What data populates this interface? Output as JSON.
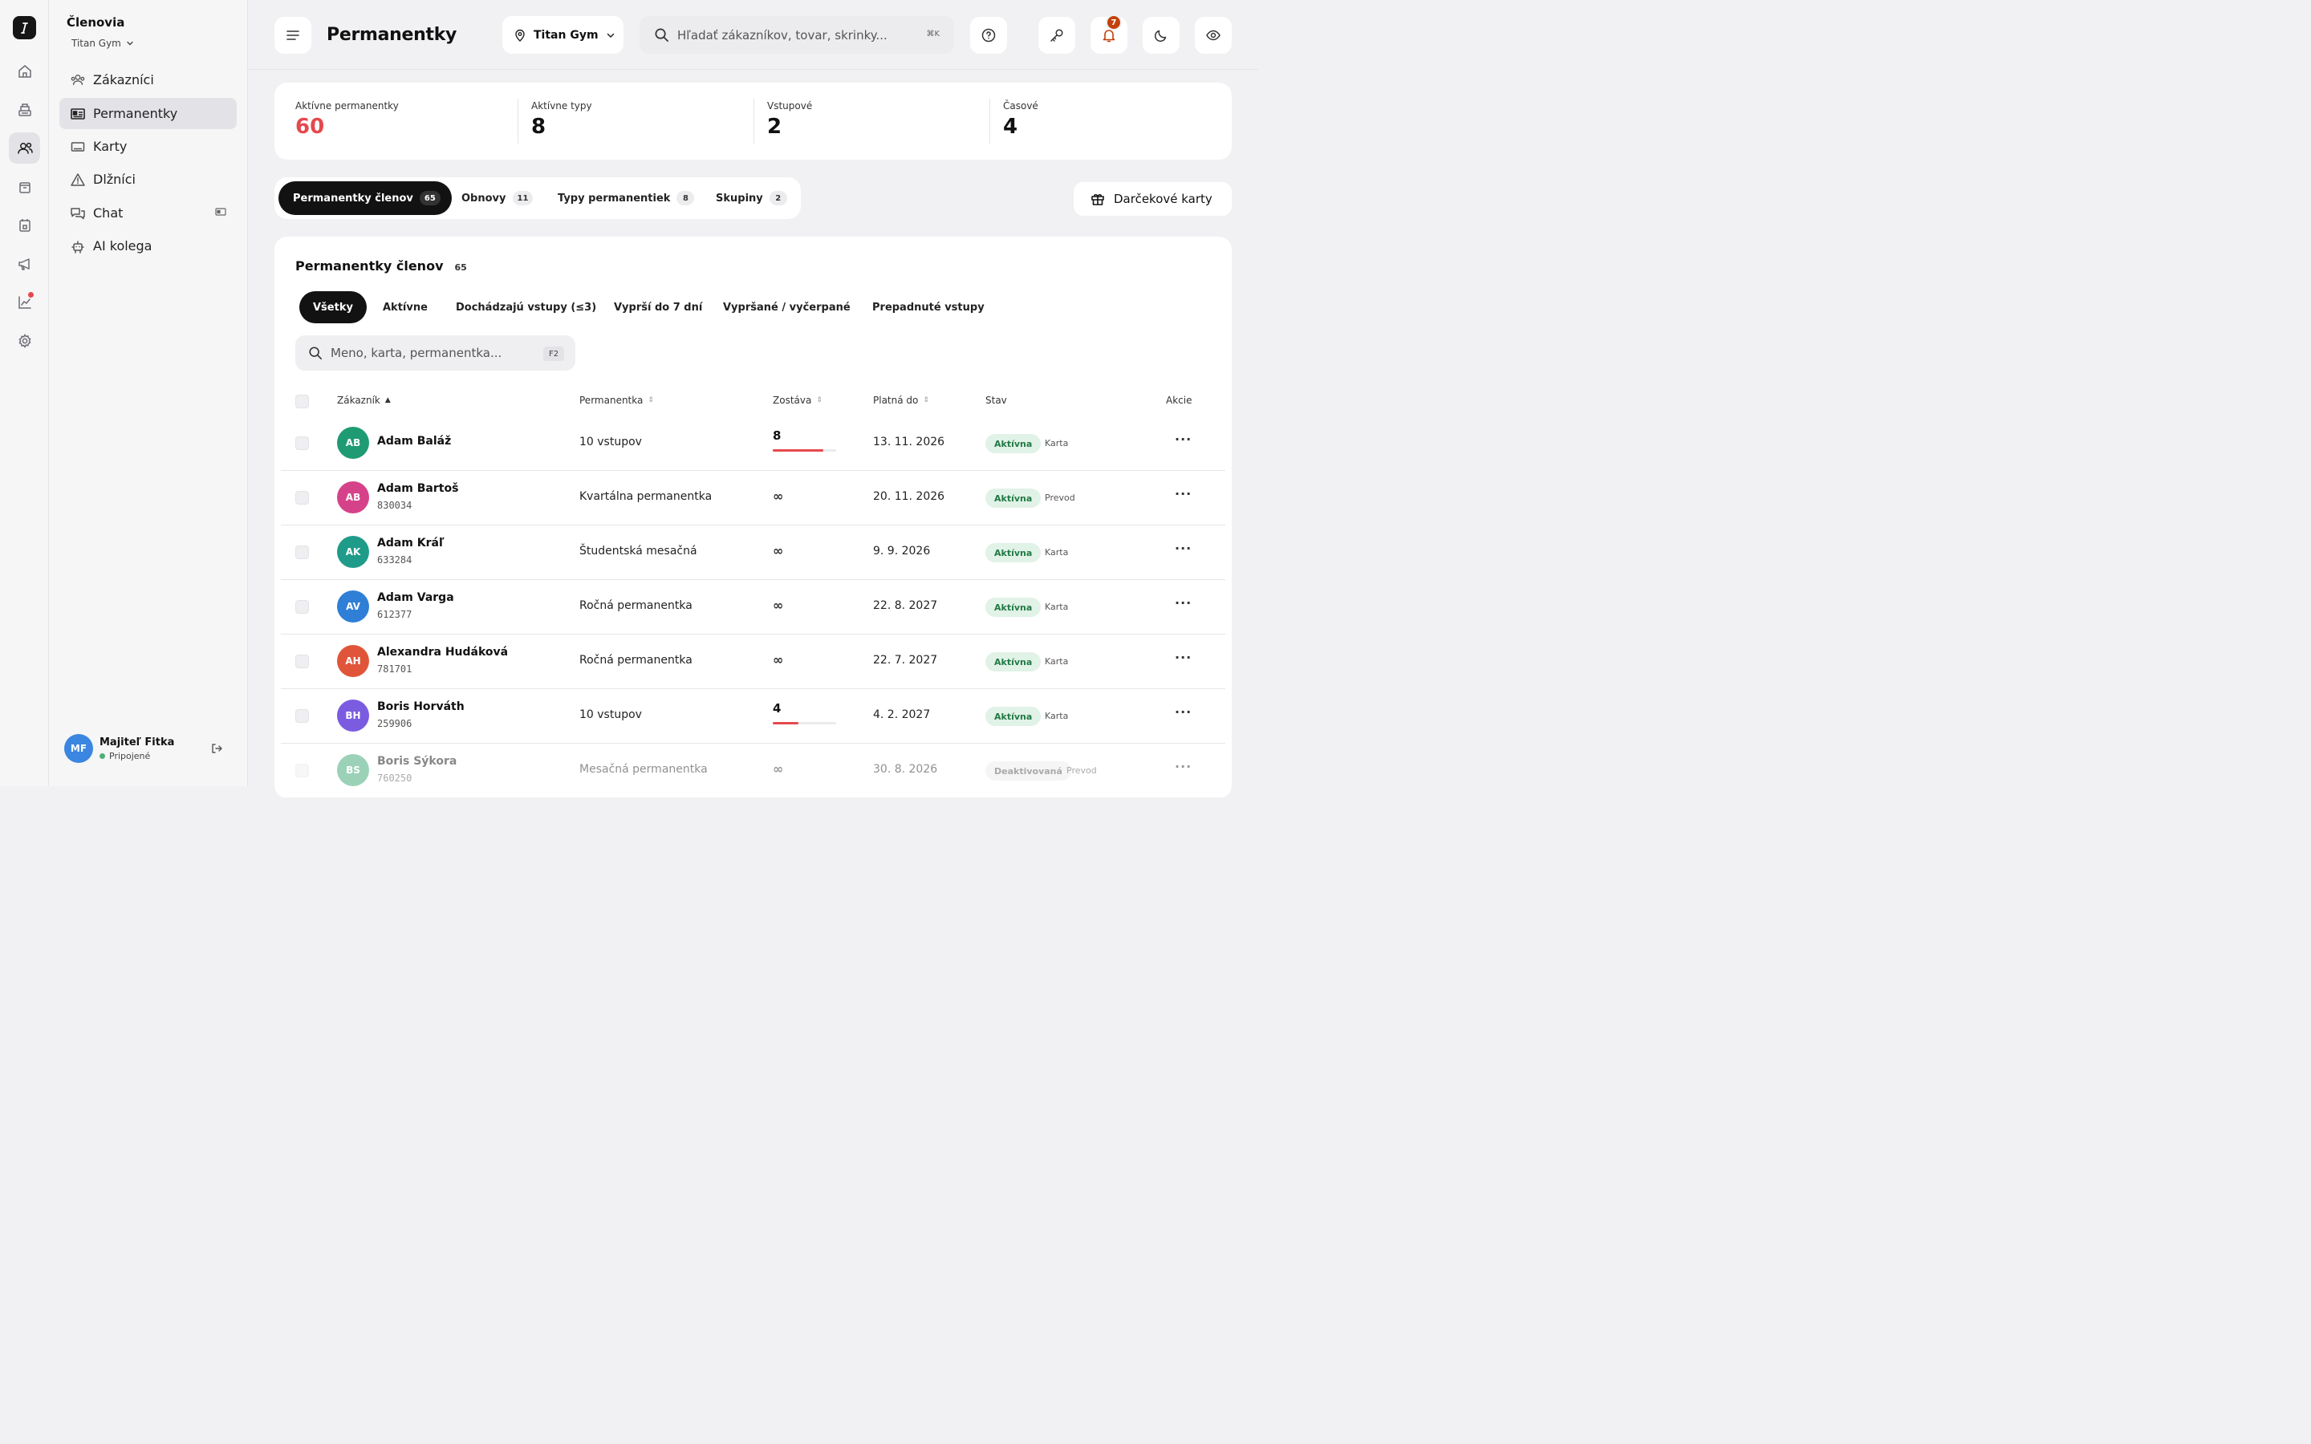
{
  "rail": {
    "items": [
      {
        "icon": "home-icon"
      },
      {
        "icon": "register-icon"
      },
      {
        "icon": "members-icon",
        "active": true
      },
      {
        "icon": "box-icon"
      },
      {
        "icon": "calendar-icon"
      },
      {
        "icon": "megaphone-icon"
      },
      {
        "icon": "analytics-icon",
        "dot": true
      },
      {
        "icon": "settings-icon"
      }
    ]
  },
  "sidebar": {
    "title": "Členovia",
    "gym": "Titan Gym",
    "items": [
      {
        "label": "Zákazníci",
        "icon": "customers-icon"
      },
      {
        "label": "Permanentky",
        "icon": "pass-icon",
        "active": true
      },
      {
        "label": "Karty",
        "icon": "card-icon"
      },
      {
        "label": "Dlžníci",
        "icon": "warning-icon"
      },
      {
        "label": "Chat",
        "icon": "chat-icon"
      },
      {
        "label": "AI kolega",
        "icon": "robot-icon"
      }
    ],
    "user": {
      "initials": "MF",
      "name": "Majiteľ Fitka",
      "status": "Pripojené"
    }
  },
  "header": {
    "title": "Permanentky",
    "location": "Titan Gym",
    "search_placeholder": "Hľadať zákazníkov, tovar, skrinky...",
    "search_shortcut": "⌘K",
    "notifications": "7"
  },
  "stats": [
    {
      "label": "Aktívne permanentky",
      "value": "60",
      "color": "#e5484d"
    },
    {
      "label": "Aktívne typy",
      "value": "8",
      "color": "#111111"
    },
    {
      "label": "Vstupové",
      "value": "2",
      "color": "#111111"
    },
    {
      "label": "Časové",
      "value": "4",
      "color": "#111111"
    }
  ],
  "tabs": [
    {
      "label": "Permanentky členov",
      "count": "65",
      "active": true
    },
    {
      "label": "Obnovy",
      "count": "11"
    },
    {
      "label": "Typy permanentiek",
      "count": "8"
    },
    {
      "label": "Skupiny",
      "count": "2"
    }
  ],
  "gift_label": "Darčekové karty",
  "table": {
    "title": "Permanentky členov",
    "count": "65",
    "filters": [
      "Všetky",
      "Aktívne",
      "Dochádzajú vstupy (≤3)",
      "Vyprší do 7 dní",
      "Vypršané / vyčerpané",
      "Prepadnuté vstupy"
    ],
    "active_filter": 0,
    "search_placeholder": "Meno, karta, permanentka...",
    "search_shortcut": "F2",
    "columns": {
      "customer": "Zákazník",
      "pass": "Permanentka",
      "remaining": "Zostáva",
      "valid": "Platná do",
      "status": "Stav",
      "actions": "Akcie"
    },
    "rows": [
      {
        "initials": "AB",
        "color": "#1f9b73",
        "name": "Adam Baláž",
        "id": "",
        "pass": "10 vstupov",
        "remaining": "8",
        "fill": 0.8,
        "valid": "13. 11. 2026",
        "status": "Aktívna",
        "method": "Karta",
        "active": true
      },
      {
        "initials": "AB",
        "color": "#d6428a",
        "name": "Adam Bartoš",
        "id": "830034",
        "pass": "Kvartálna permanentka",
        "remaining": "∞",
        "valid": "20. 11. 2026",
        "status": "Aktívna",
        "method": "Prevod",
        "active": true
      },
      {
        "initials": "AK",
        "color": "#1f9b8a",
        "name": "Adam Kráľ",
        "id": "633284",
        "pass": "Študentská mesačná",
        "remaining": "∞",
        "valid": "9. 9. 2026",
        "status": "Aktívna",
        "method": "Karta",
        "active": true
      },
      {
        "initials": "AV",
        "color": "#2f7fd6",
        "name": "Adam Varga",
        "id": "612377",
        "pass": "Ročná permanentka",
        "remaining": "∞",
        "valid": "22. 8. 2027",
        "status": "Aktívna",
        "method": "Karta",
        "active": true
      },
      {
        "initials": "AH",
        "color": "#e0553a",
        "name": "Alexandra Hudáková",
        "id": "781701",
        "pass": "Ročná permanentka",
        "remaining": "∞",
        "valid": "22. 7. 2027",
        "status": "Aktívna",
        "method": "Karta",
        "active": true
      },
      {
        "initials": "BH",
        "color": "#7b5ce0",
        "name": "Boris Horváth",
        "id": "259906",
        "pass": "10 vstupov",
        "remaining": "4",
        "fill": 0.4,
        "valid": "4. 2. 2027",
        "status": "Aktívna",
        "method": "Karta",
        "active": true
      },
      {
        "initials": "BS",
        "color": "#3aa672",
        "name": "Boris Sýkora",
        "id": "760250",
        "pass": "Mesačná permanentka",
        "remaining": "∞",
        "valid": "30. 8. 2026",
        "status": "Deaktivovaná",
        "method": "Prevod",
        "active": false
      }
    ]
  }
}
